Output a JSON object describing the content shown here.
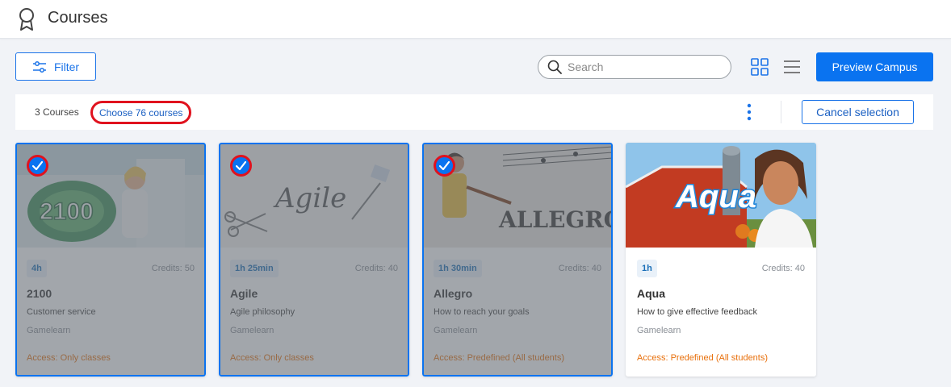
{
  "header": {
    "title": "Courses",
    "icon": "award-icon"
  },
  "toolbar": {
    "filter_label": "Filter",
    "search_placeholder": "Search",
    "preview_label": "Preview Campus",
    "accent_color": "#0a73f0"
  },
  "selection": {
    "count_text": "3 Courses",
    "choose_label": "Choose 76 courses",
    "cancel_label": "Cancel selection"
  },
  "courses": [
    {
      "duration": "4h",
      "credits": "Credits: 50",
      "title": "2100",
      "subtitle": "Customer service",
      "provider": "Gamelearn",
      "access": "Access: Only classes",
      "selected": true
    },
    {
      "duration": "1h 25min",
      "credits": "Credits: 40",
      "title": "Agile",
      "subtitle": "Agile philosophy",
      "provider": "Gamelearn",
      "access": "Access: Only classes",
      "selected": true
    },
    {
      "duration": "1h 30min",
      "credits": "Credits: 40",
      "title": "Allegro",
      "subtitle": "How to reach your goals",
      "provider": "Gamelearn",
      "access": "Access: Predefined (All students)",
      "selected": true
    },
    {
      "duration": "1h",
      "credits": "Credits: 40",
      "title": "Aqua",
      "subtitle": "How to give effective feedback",
      "provider": "Gamelearn",
      "access": "Access: Predefined (All students)",
      "selected": false
    }
  ],
  "artwork": {
    "logo_2100": "2100",
    "logo_agile": "Agile",
    "logo_allegro": "ALLEGRO",
    "logo_aqua": "Aqua"
  }
}
